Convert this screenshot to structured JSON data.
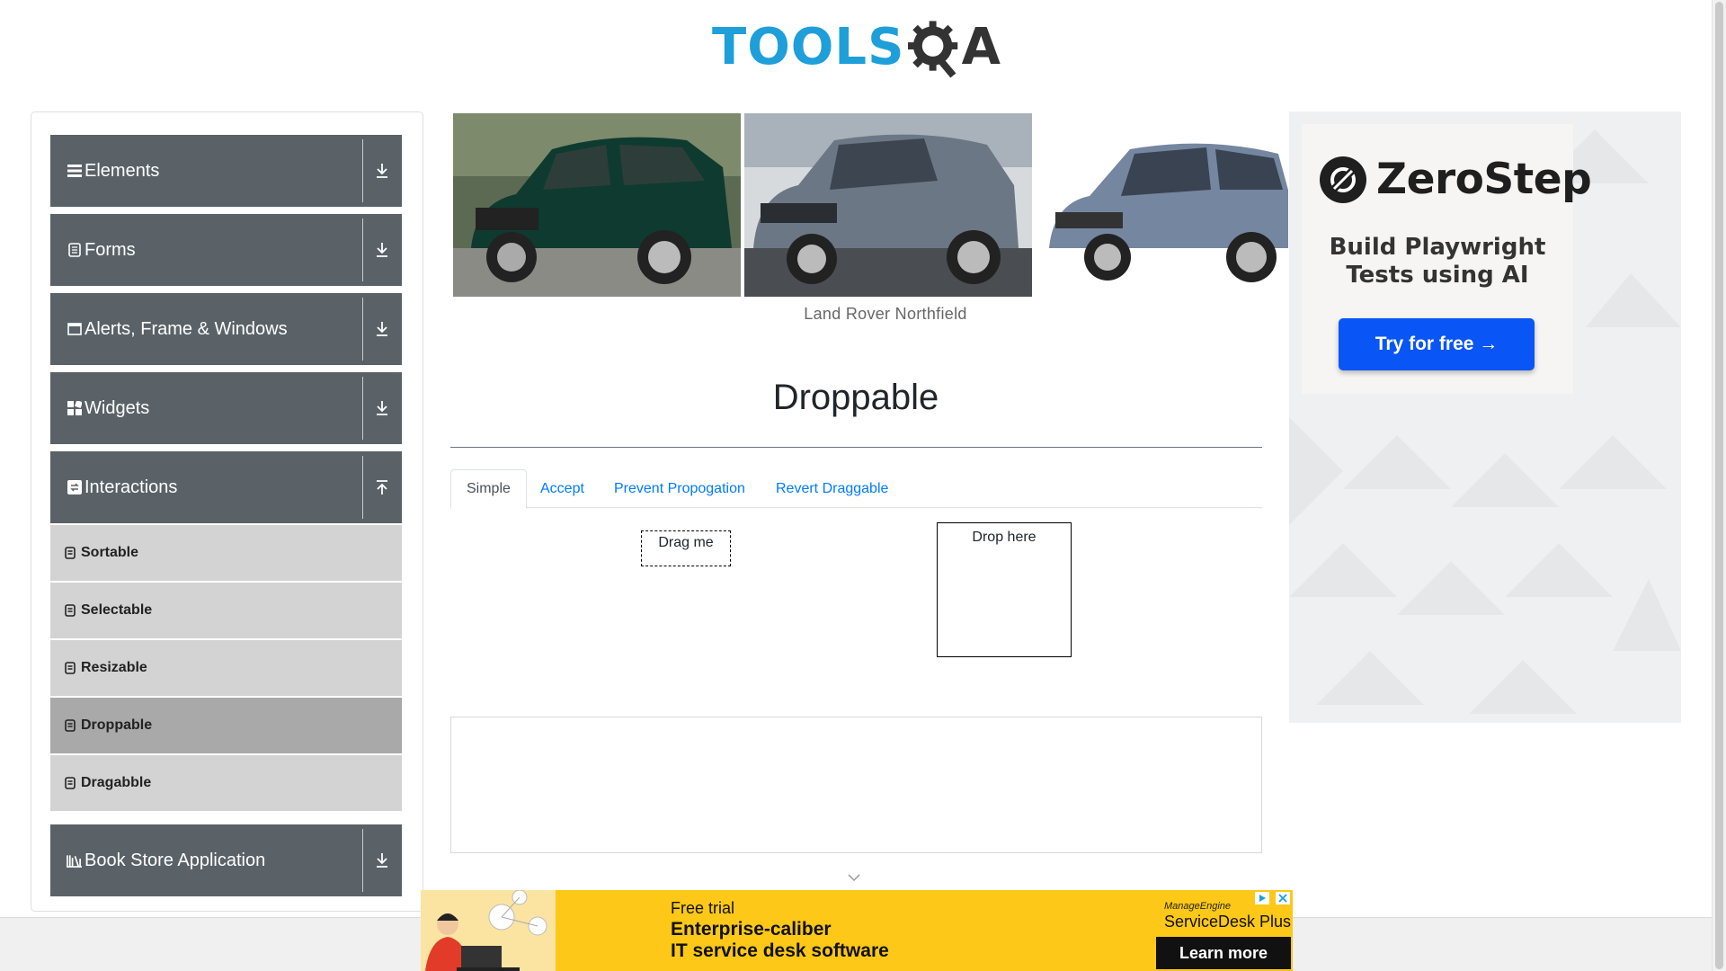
{
  "header": {
    "logo_text": "TOOLS",
    "logo_suffix": "A"
  },
  "sidebar": {
    "groups": [
      {
        "label": "Elements",
        "icon": "hamburger-icon",
        "arrow": "download"
      },
      {
        "label": "Forms",
        "icon": "document-icon",
        "arrow": "download"
      },
      {
        "label": "Alerts, Frame & Windows",
        "icon": "window-icon",
        "arrow": "download"
      },
      {
        "label": "Widgets",
        "icon": "widgets-icon",
        "arrow": "download"
      },
      {
        "label": "Interactions",
        "icon": "interactions-icon",
        "arrow": "upload"
      },
      {
        "label": "Book Store Application",
        "icon": "library-icon",
        "arrow": "download"
      }
    ],
    "interactions_items": [
      {
        "label": "Sortable"
      },
      {
        "label": "Selectable"
      },
      {
        "label": "Resizable"
      },
      {
        "label": "Droppable",
        "active": true
      },
      {
        "label": "Dragabble"
      }
    ]
  },
  "carousel": {
    "caption": "Land Rover Northfield"
  },
  "main": {
    "title": "Droppable",
    "tabs": [
      {
        "label": "Simple",
        "active": true
      },
      {
        "label": "Accept"
      },
      {
        "label": "Prevent Propogation"
      },
      {
        "label": "Revert Draggable"
      }
    ],
    "drag_label": "Drag me",
    "drop_label": "Drop here"
  },
  "side_ad": {
    "brand": "ZeroStep",
    "tagline_line1": "Build Playwright",
    "tagline_line2": "Tests using AI",
    "cta": "Try for free →",
    "accent": "#0a55f5"
  },
  "bottom_ad": {
    "kicker": "Free trial",
    "headline_line1": "Enterprise-caliber",
    "headline_line2": "IT service desk software",
    "brand_small": "ManageEngine",
    "brand_product": "ServiceDesk Plus",
    "cta": "Learn more",
    "background": "#fdc817"
  },
  "colors": {
    "sidebar_header": "#5a6268",
    "sub_item": "#d3d3d3",
    "sub_item_active": "#a9a9a9",
    "link": "#007bff",
    "logo": "#1e9fd9"
  }
}
